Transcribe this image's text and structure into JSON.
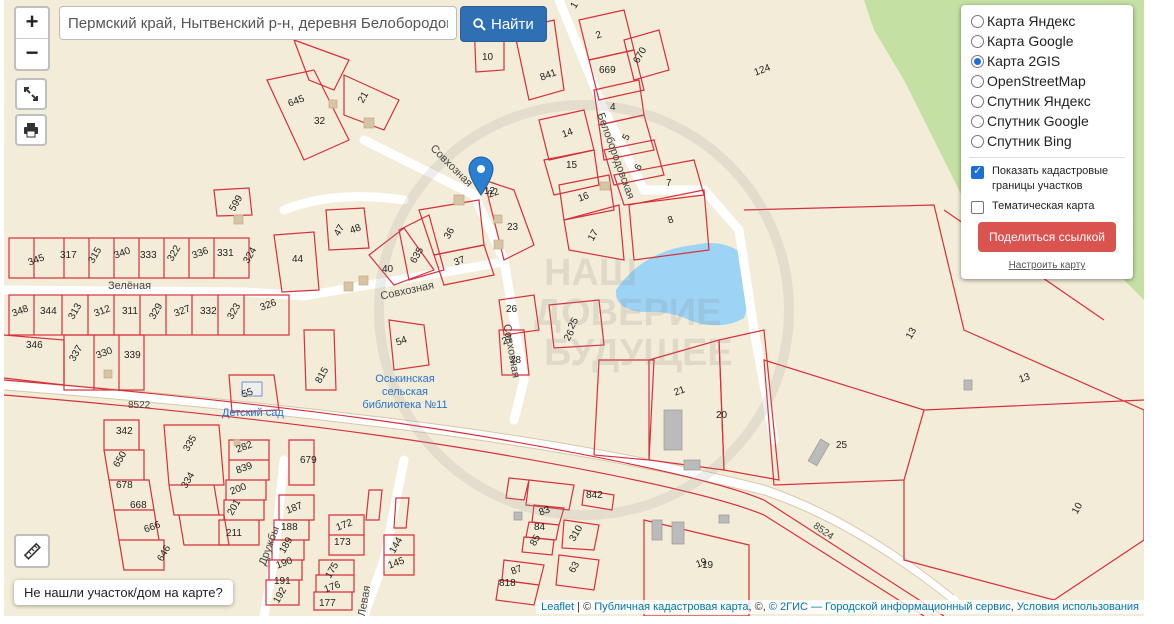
{
  "search": {
    "value": "Пермский край, Нытвенский р-н, деревня Белобородово, ул",
    "button_label": "Найти"
  },
  "zoom": {
    "in_label": "+",
    "out_label": "−"
  },
  "layers": {
    "base_options": [
      {
        "label": "Карта Яндекс",
        "selected": false
      },
      {
        "label": "Карта Google",
        "selected": false
      },
      {
        "label": "Карта 2GIS",
        "selected": true
      },
      {
        "label": "OpenStreetMap",
        "selected": false
      },
      {
        "label": "Спутник Яндекс",
        "selected": false
      },
      {
        "label": "Спутник Google",
        "selected": false
      },
      {
        "label": "Спутник Bing",
        "selected": false
      }
    ],
    "cadastral_label": "Показать кадастровые границы участков",
    "cadastral_checked": true,
    "thematic_label": "Тематическая карта",
    "thematic_checked": false,
    "share_label": "Поделиться ссылкой",
    "setup_label": "Настроить карту"
  },
  "not_found_label": "Не нашли участок/дом на карте?",
  "attribution": {
    "leaflet": "Leaflet",
    "sep1": " | © ",
    "pkk": "Публичная кадастровая карта",
    "sep2": ", ©, ",
    "gis": "© 2ГИС — Городской информационный сервис",
    "sep3": ", ",
    "terms": "Условия использования"
  },
  "map": {
    "streets": [
      "Совхозная",
      "Совхозная",
      "Зелёная",
      "Совхозная",
      "Белобородовская",
      "Дружбы",
      "Левая"
    ],
    "roads": [
      "8522",
      "8524"
    ],
    "poi": [
      "Оськинская сельская библиотека №11",
      "Детский сад"
    ],
    "watermark": "НАШ ДОВЕРИЕ БУДУЩЕЕ",
    "parcel_numbers": [
      "1",
      "2",
      "10",
      "11",
      "841",
      "669",
      "670",
      "124",
      "4",
      "5",
      "14",
      "15",
      "6",
      "16",
      "7",
      "17",
      "8",
      "19",
      "21",
      "645",
      "32",
      "599",
      "22",
      "23",
      "36",
      "37",
      "40",
      "47",
      "48",
      "44",
      "635",
      "345",
      "317",
      "315",
      "340",
      "333",
      "322",
      "336",
      "331",
      "324",
      "348",
      "344",
      "313",
      "312",
      "311",
      "329",
      "327",
      "332",
      "323",
      "326",
      "346",
      "337",
      "330",
      "339",
      "815",
      "54",
      "26",
      "25",
      "27",
      "28",
      "26",
      "21",
      "20",
      "13",
      "13",
      "25",
      "10",
      "55",
      "342",
      "335",
      "282",
      "679",
      "650",
      "839",
      "678",
      "334",
      "200",
      "668",
      "201",
      "666",
      "211",
      "646",
      "187",
      "188",
      "189",
      "190",
      "191",
      "192",
      "172",
      "173",
      "175",
      "176",
      "177",
      "144",
      "145",
      "842",
      "310",
      "83",
      "84",
      "85",
      "87",
      "818",
      "63",
      "19",
      "12"
    ],
    "colors": {
      "background": "#f3ecd9",
      "green": "#c5e0a3",
      "water": "#9dd3f5",
      "parcel_line": "#d8303a",
      "marker": "#2a7fd0"
    }
  }
}
